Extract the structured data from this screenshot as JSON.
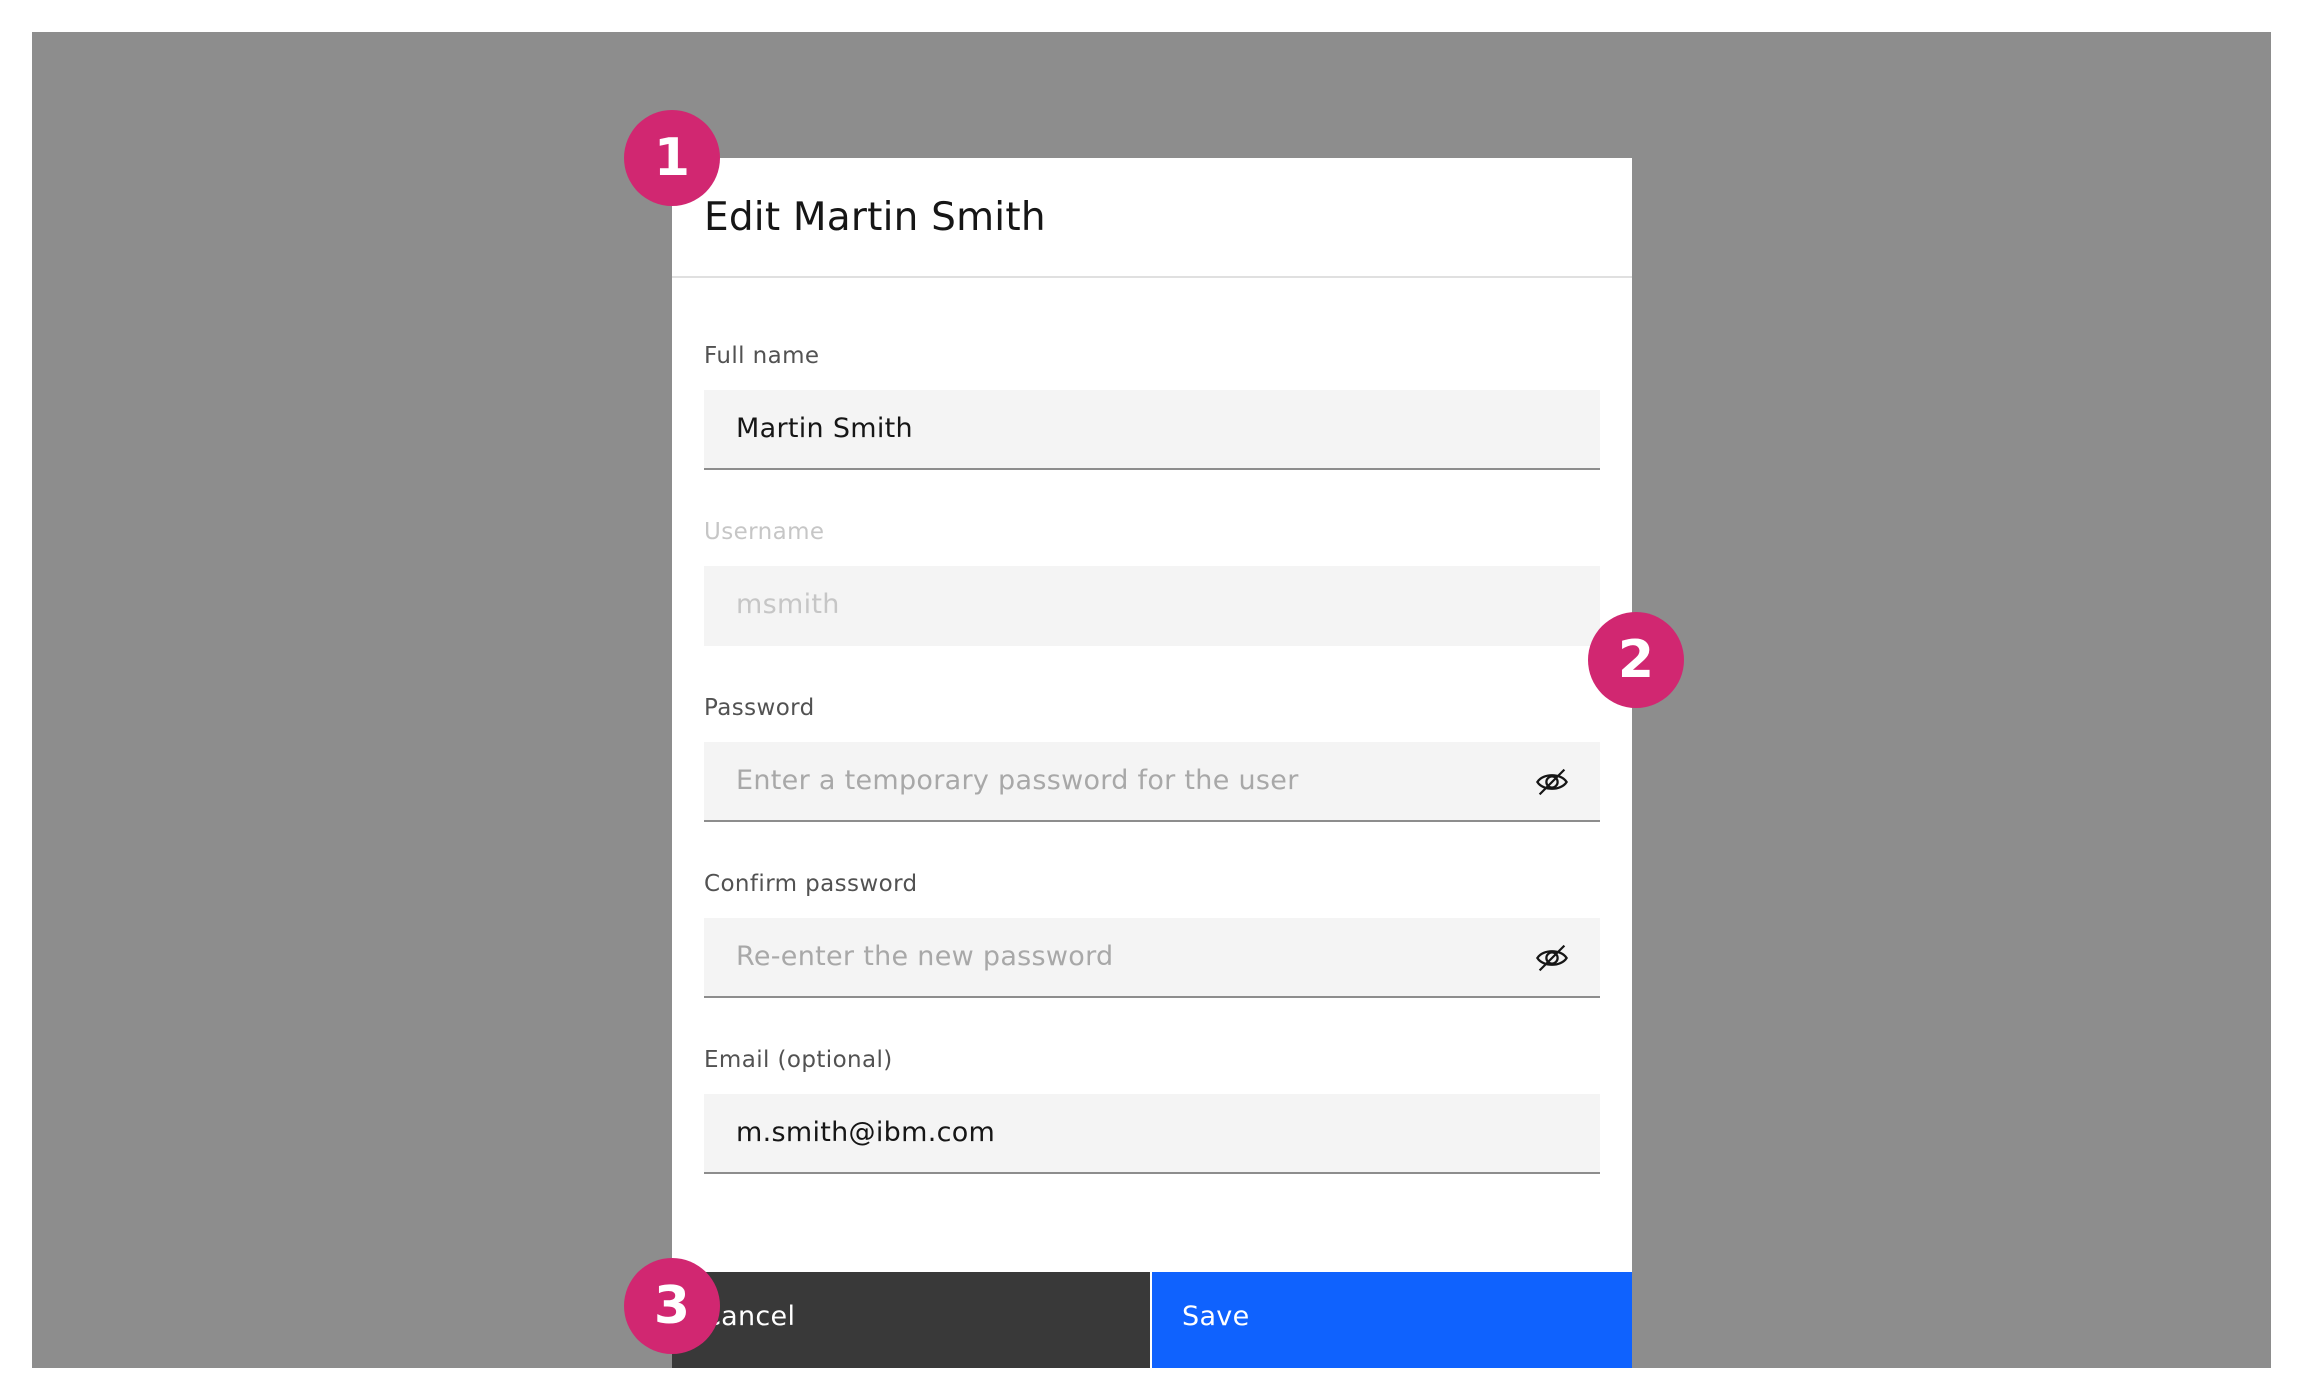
{
  "modal": {
    "title": "Edit Martin Smith"
  },
  "fields": {
    "full_name": {
      "label": "Full name",
      "value": "Martin Smith"
    },
    "username": {
      "label": "Username",
      "value": "msmith"
    },
    "password": {
      "label": "Password",
      "placeholder": "Enter a temporary password for the user",
      "icon": "eye-off-icon"
    },
    "confirm_password": {
      "label": "Confirm password",
      "placeholder": "Re-enter the new password",
      "icon": "eye-off-icon"
    },
    "email": {
      "label": "Email (optional)",
      "value": "m.smith@ibm.com"
    }
  },
  "buttons": {
    "cancel_label": "Cancel",
    "save_label": "Save"
  },
  "badges": [
    "1",
    "2",
    "3"
  ],
  "colors": {
    "overlay": "#8d8d8d",
    "primary_button": "#0f62fe",
    "secondary_button": "#393939",
    "badge": "#d12771"
  }
}
